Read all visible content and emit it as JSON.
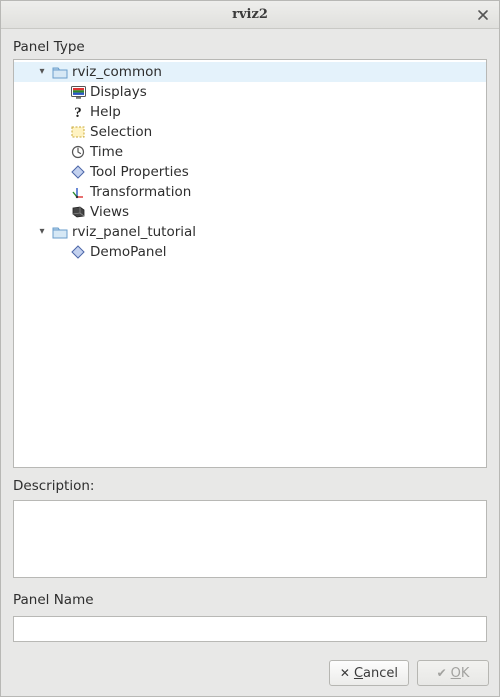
{
  "window": {
    "title": "rviz2"
  },
  "labels": {
    "panel_type": "Panel Type",
    "description": "Description:",
    "panel_name": "Panel Name"
  },
  "tree": {
    "groups": [
      {
        "name": "rviz_common",
        "selected": true,
        "items": [
          {
            "icon": "displays-icon",
            "label": "Displays"
          },
          {
            "icon": "help-icon",
            "label": "Help"
          },
          {
            "icon": "selection-icon",
            "label": "Selection"
          },
          {
            "icon": "time-icon",
            "label": "Time"
          },
          {
            "icon": "tool-properties-icon",
            "label": "Tool Properties"
          },
          {
            "icon": "transformation-icon",
            "label": "Transformation"
          },
          {
            "icon": "views-icon",
            "label": "Views"
          }
        ]
      },
      {
        "name": "rviz_panel_tutorial",
        "selected": false,
        "items": [
          {
            "icon": "demo-panel-icon",
            "label": "DemoPanel"
          }
        ]
      }
    ]
  },
  "description_text": "",
  "panel_name_value": "",
  "buttons": {
    "cancel": "Cancel",
    "ok": "OK",
    "ok_enabled": false
  }
}
